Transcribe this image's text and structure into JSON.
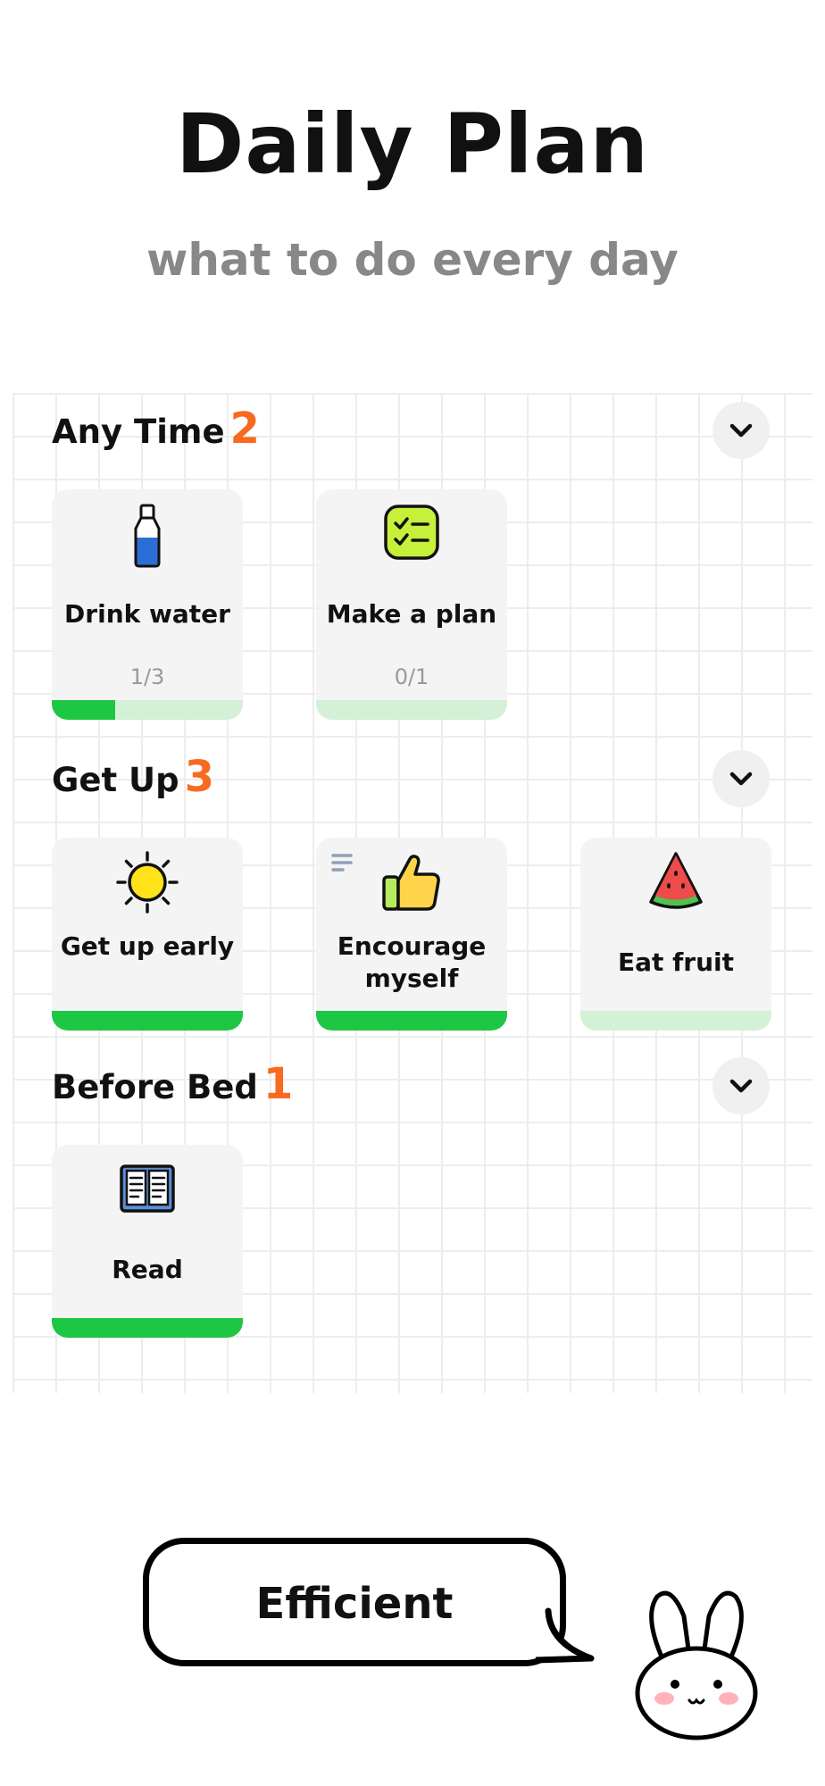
{
  "header": {
    "title": "Daily Plan",
    "subtitle": "what to do every day"
  },
  "sections": [
    {
      "name": "Any Time",
      "count": "2",
      "cards": [
        {
          "name": "Drink water",
          "icon": "water-bottle-icon",
          "progress_text": "1/3",
          "progress": 0.33
        },
        {
          "name": "Make a plan",
          "icon": "checklist-icon",
          "progress_text": "0/1",
          "progress": 0
        }
      ]
    },
    {
      "name": "Get Up",
      "count": "3",
      "cards": [
        {
          "name": "Get up early",
          "icon": "sun-icon",
          "progress": 1
        },
        {
          "name": "Encourage myself",
          "icon": "thumbs-up-icon",
          "progress": 1
        },
        {
          "name": "Eat fruit",
          "icon": "watermelon-icon",
          "progress": 0
        }
      ]
    },
    {
      "name": "Before Bed",
      "count": "1",
      "cards": [
        {
          "name": "Read",
          "icon": "book-icon",
          "progress": 1
        }
      ]
    }
  ],
  "mascot": {
    "speech": "Efficient",
    "icon": "bunny-icon"
  },
  "colors": {
    "accent": "#f86a1f",
    "progress_fill": "#1ec743",
    "progress_track": "#d4f1d7"
  }
}
